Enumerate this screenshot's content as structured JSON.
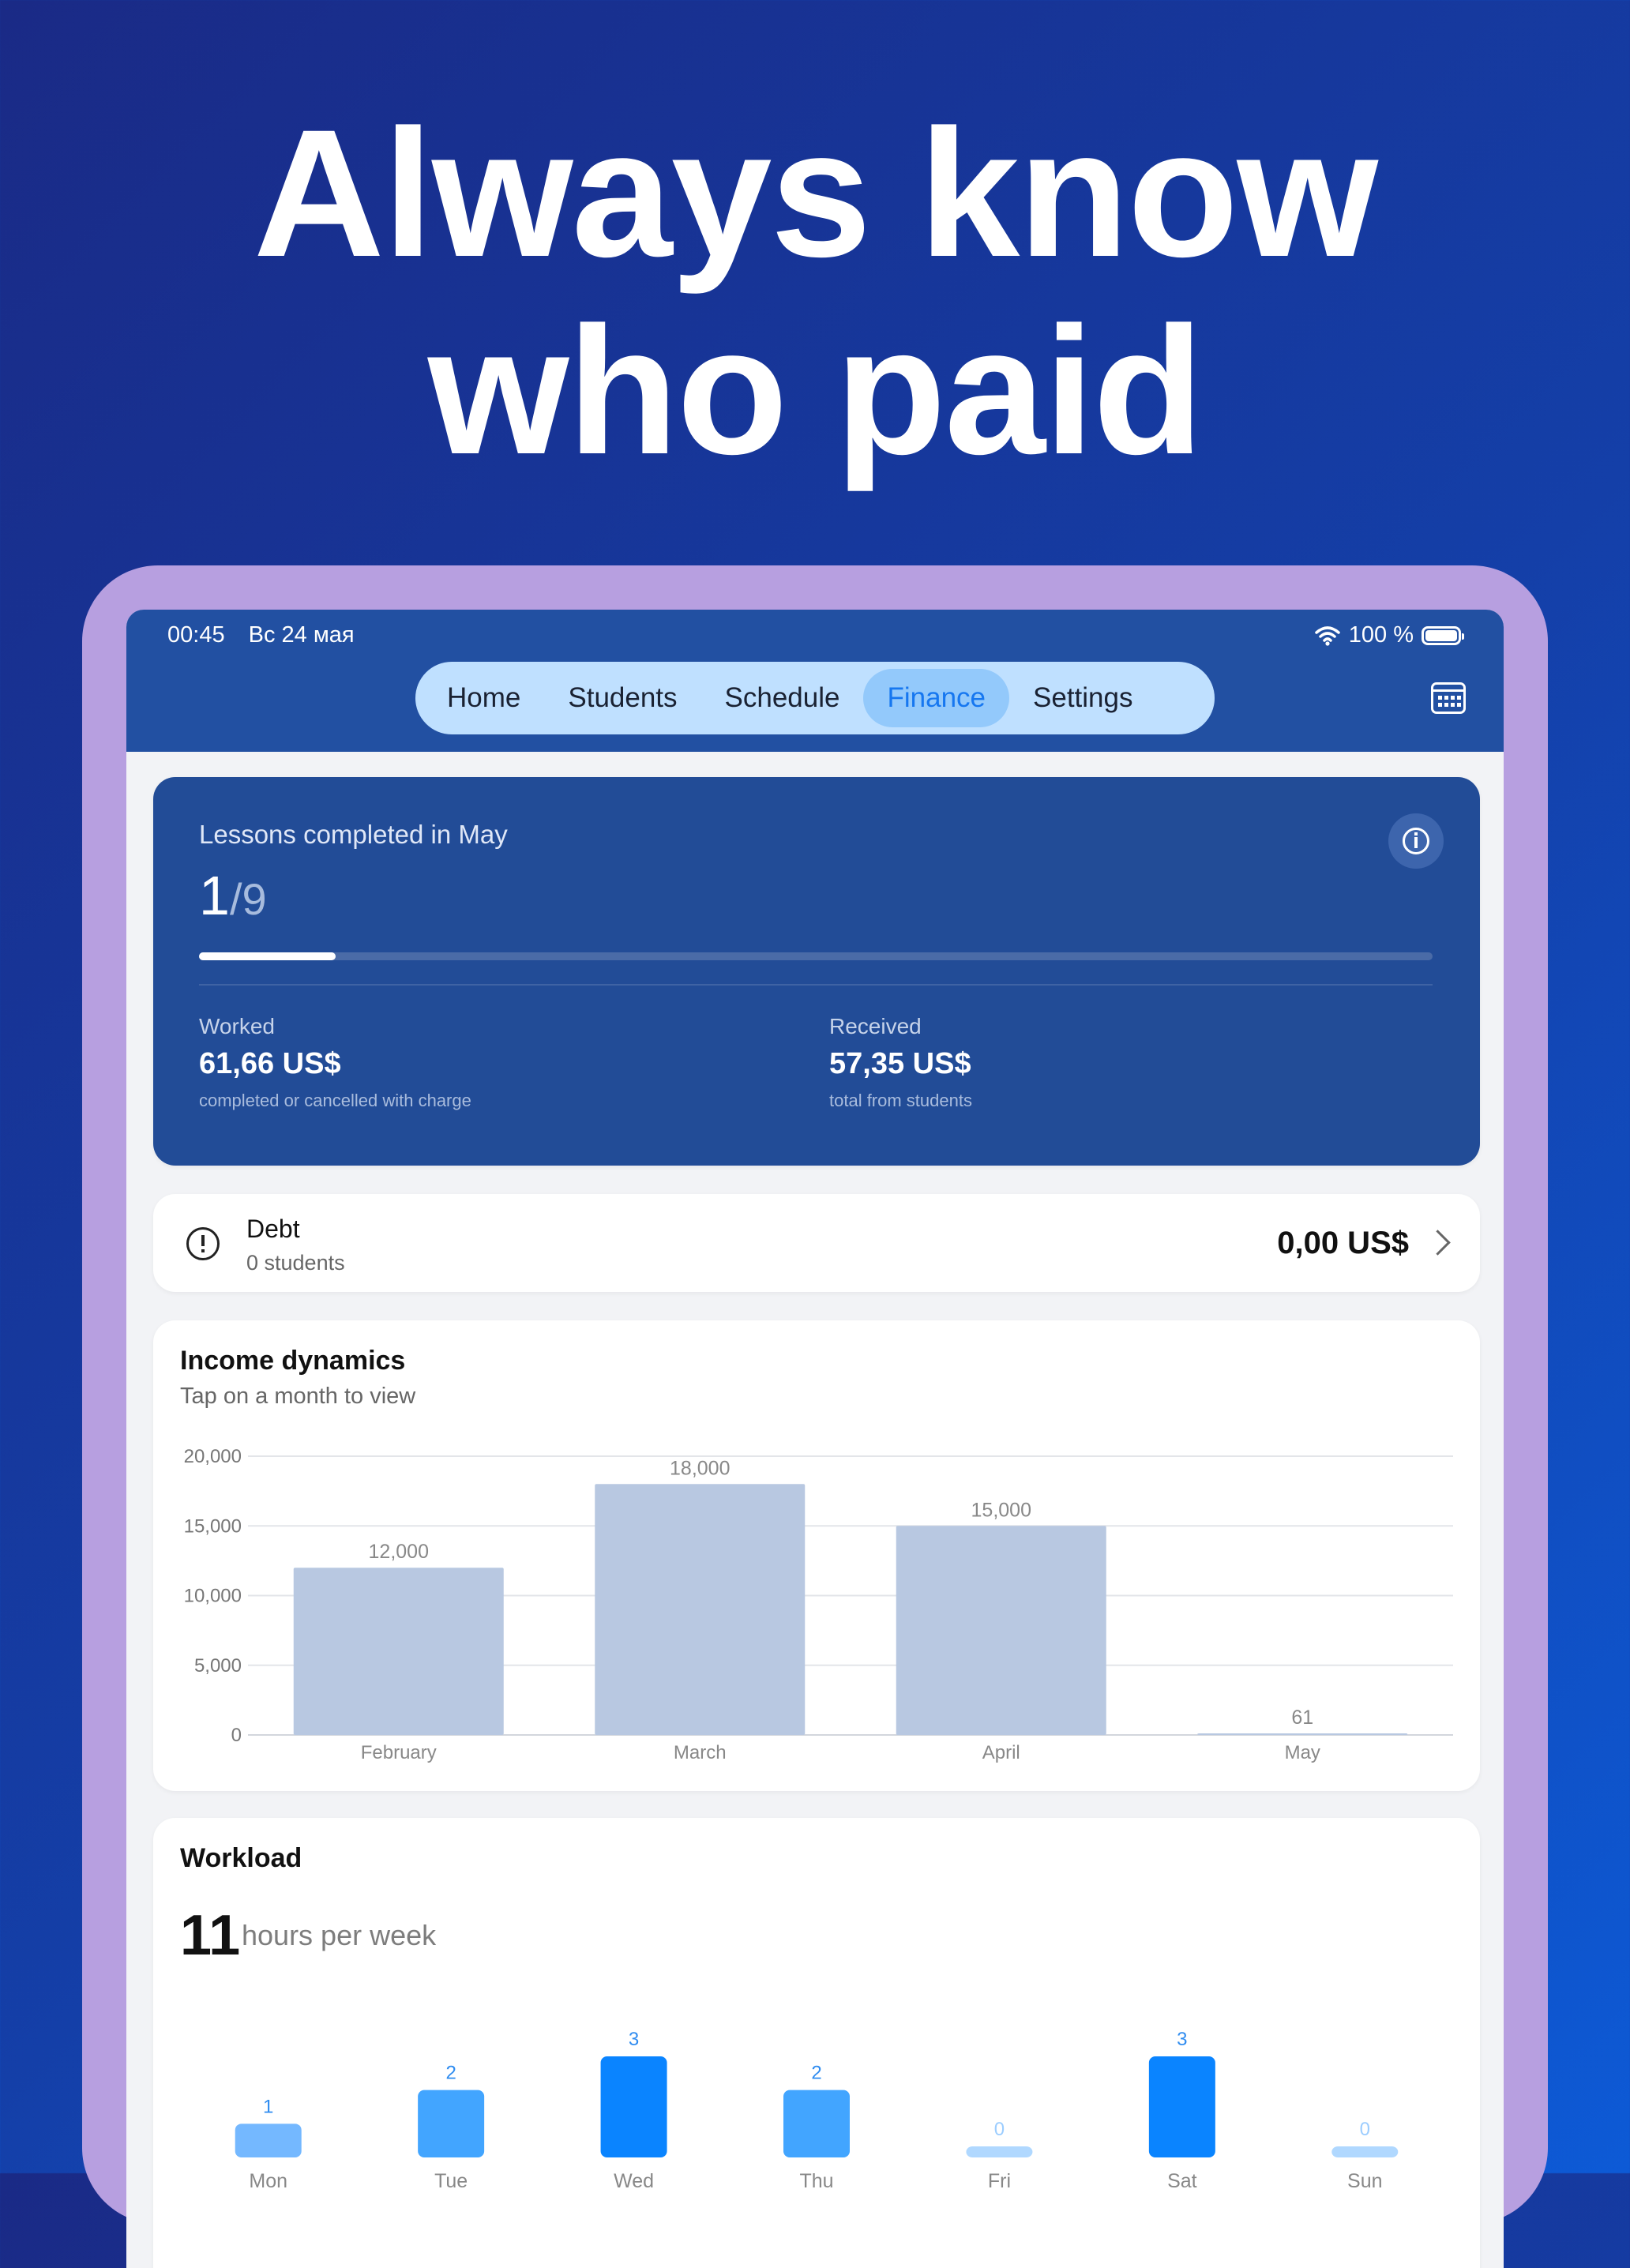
{
  "headline": {
    "line1": "Always know",
    "line2": "who paid"
  },
  "status_bar": {
    "time": "00:45",
    "date": "Вс 24 мая",
    "battery": "100 %"
  },
  "nav": {
    "tabs": [
      {
        "label": "Home",
        "active": false
      },
      {
        "label": "Students",
        "active": false
      },
      {
        "label": "Schedule",
        "active": false
      },
      {
        "label": "Finance",
        "active": true
      },
      {
        "label": "Settings",
        "active": false
      }
    ]
  },
  "lessons": {
    "title": "Lessons completed in May",
    "completed": "1",
    "total": "/9",
    "progress_fraction": 0.111,
    "worked": {
      "label": "Worked",
      "value": "61,66 US$",
      "sub": "completed or cancelled with charge"
    },
    "received": {
      "label": "Received",
      "value": "57,35 US$",
      "sub": "total from students"
    }
  },
  "debt": {
    "title": "Debt",
    "subtitle": "0 students",
    "amount": "0,00 US$"
  },
  "income": {
    "title": "Income dynamics",
    "subtitle": "Tap on a month to view"
  },
  "workload": {
    "title": "Workload",
    "hours": "11",
    "unit": "hours per week"
  },
  "colors": {
    "accent": "#1677f0",
    "nav_bar": "#2250a2",
    "lessons_card": "#224c97",
    "income_bar": "#b8c8e1",
    "workload_strong": "#0a84ff",
    "workload_mid": "#42a5ff",
    "workload_light": "#74b8ff",
    "workload_zero": "#b0d8ff"
  },
  "chart_data": [
    {
      "type": "bar",
      "title": "Income dynamics",
      "categories": [
        "February",
        "March",
        "April",
        "May"
      ],
      "values": [
        12000,
        18000,
        15000,
        61
      ],
      "value_labels": [
        "12,000",
        "18,000",
        "15,000",
        "61"
      ],
      "yticks": [
        "0",
        "5,000",
        "10,000",
        "15,000",
        "20,000"
      ],
      "ylim": [
        0,
        20000
      ],
      "grid": true
    },
    {
      "type": "bar",
      "title": "Workload",
      "categories": [
        "Mon",
        "Tue",
        "Wed",
        "Thu",
        "Fri",
        "Sat",
        "Sun"
      ],
      "values": [
        1,
        2,
        3,
        2,
        0,
        3,
        0
      ],
      "ylim": [
        0,
        3
      ],
      "grid": false
    }
  ]
}
